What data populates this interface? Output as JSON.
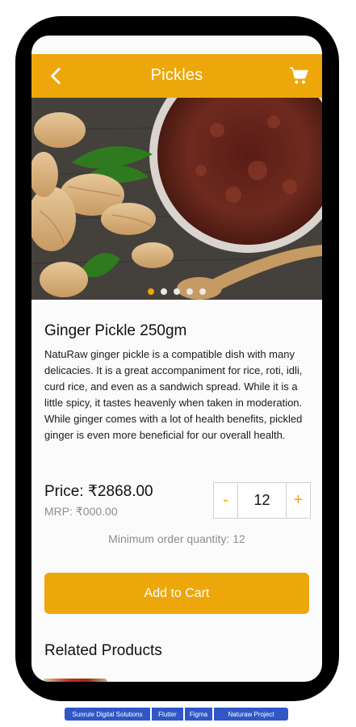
{
  "app_bar": {
    "title": "Pickles",
    "back_icon": "chevron-left-icon",
    "cart_icon": "shopping-cart-icon"
  },
  "carousel": {
    "image": "ginger and pickle in bowl",
    "dot_count": 5,
    "active_index": 0
  },
  "product": {
    "title": "Ginger Pickle 250gm",
    "description": "NatuRaw ginger pickle is a compatible dish with many delicacies. It is a great accompaniment for rice, roti, idli, curd rice, and even as a sandwich spread. While it is a little spicy, it tastes heavenly when taken in moderation. While ginger comes with a lot of health benefits, pickled ginger is even more beneficial for our overall health.",
    "price_label": "Price: ₹2868.00",
    "mrp_label": "MRP: ₹000.00",
    "quantity": {
      "decrement": "-",
      "value": "12",
      "increment": "+"
    },
    "min_order": "Minimum order quantity: 12",
    "add_to_cart": "Add to Cart"
  },
  "related": {
    "heading": "Related Products"
  },
  "footer_tags": [
    "Sunrule Digital Solutions",
    "Flutter",
    "Figma",
    "Naturaw Project"
  ],
  "colors": {
    "accent": "#eea70a",
    "background": "#fbfbfb",
    "tag_blue": "#2f57c8"
  }
}
